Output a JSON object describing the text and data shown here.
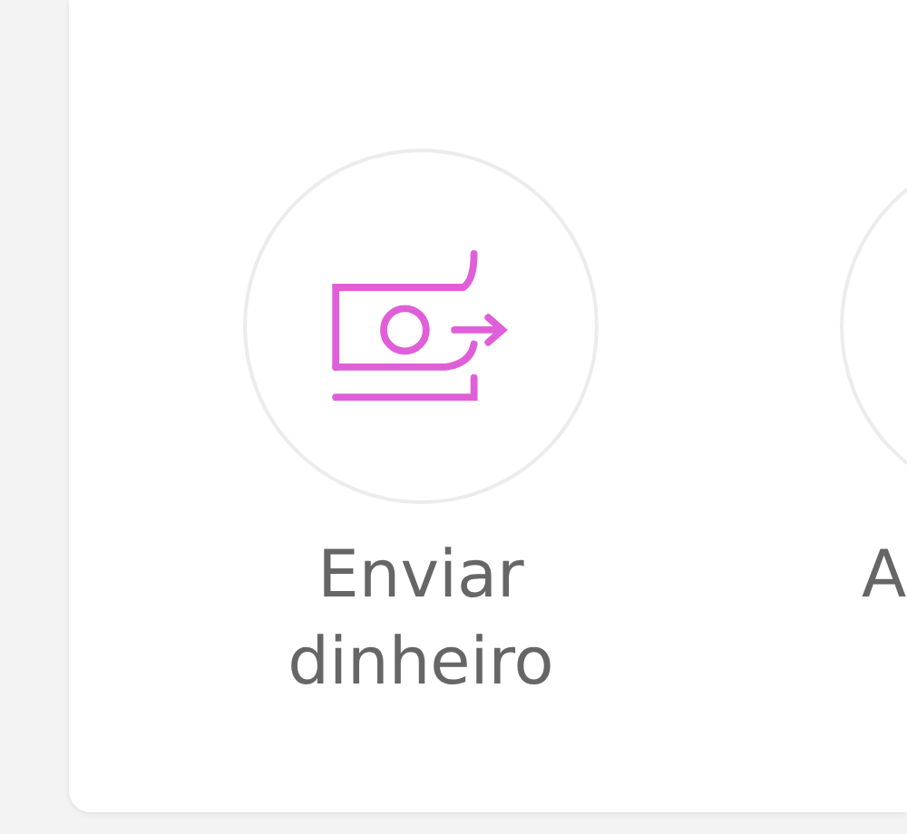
{
  "actions": [
    {
      "label": "Enviar dinheiro"
    },
    {
      "label": "A"
    }
  ]
}
